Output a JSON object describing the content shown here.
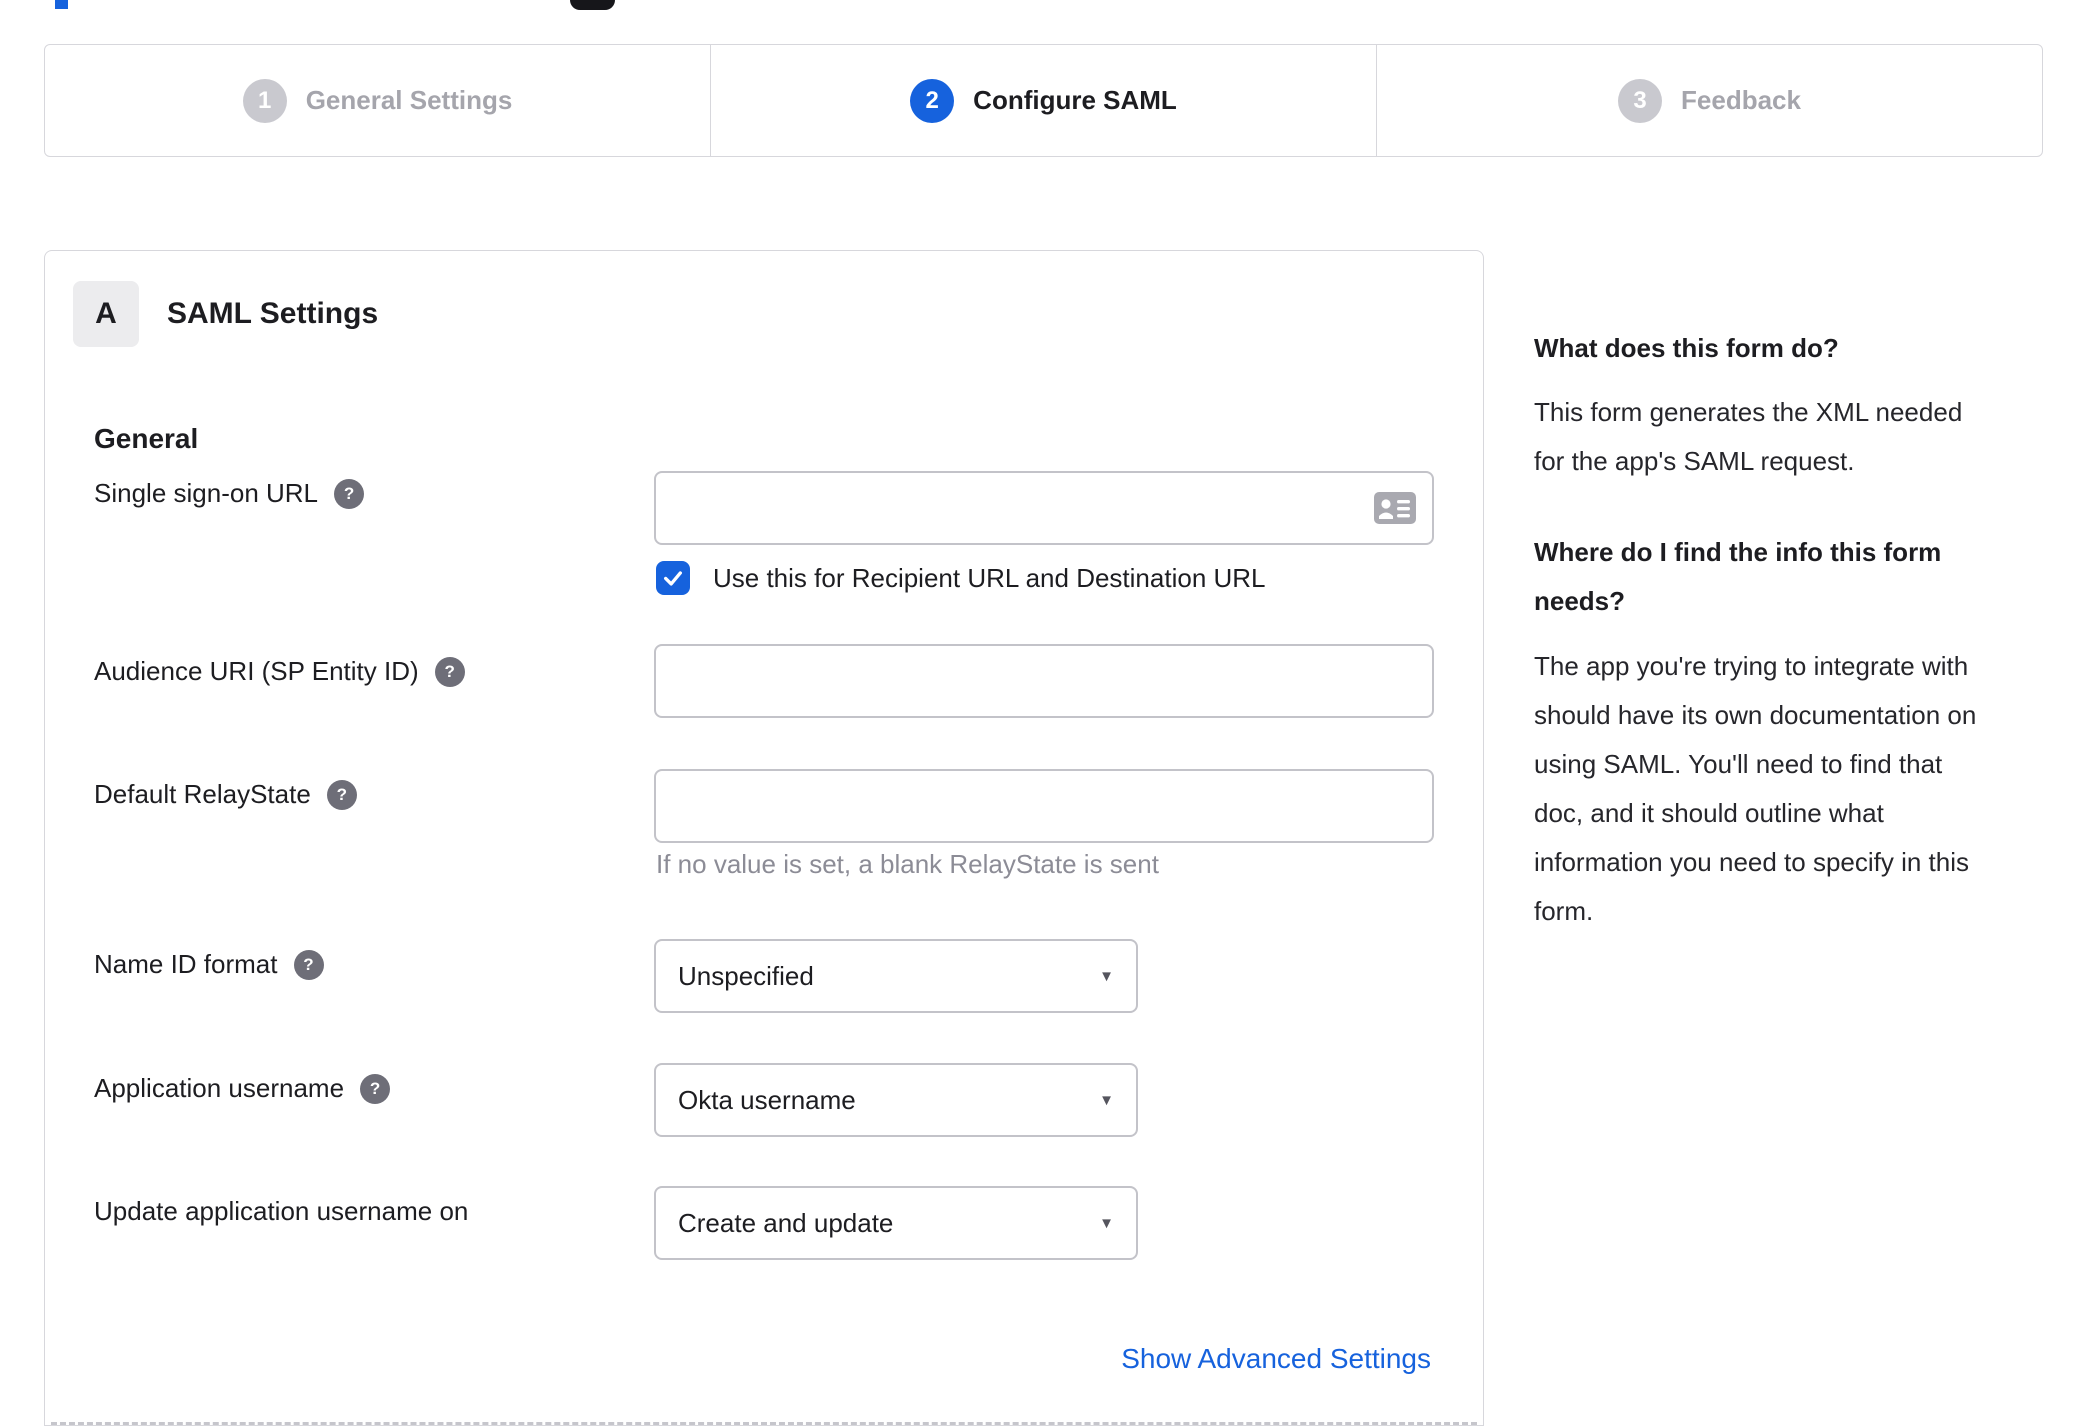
{
  "colors": {
    "accent_blue": "#1662dd",
    "inactive_gray": "#c9c9cf",
    "border_gray": "#d7d7dc",
    "helper_gray": "#8c8c96"
  },
  "stepper": {
    "steps": [
      {
        "number": "1",
        "label": "General Settings",
        "state": "inactive"
      },
      {
        "number": "2",
        "label": "Configure SAML",
        "state": "active"
      },
      {
        "number": "3",
        "label": "Feedback",
        "state": "inactive"
      }
    ]
  },
  "panel": {
    "badge": "A",
    "title": "SAML Settings",
    "section_heading": "General",
    "rows": [
      {
        "label": "Single sign-on URL",
        "value": "",
        "checkbox_label": "Use this for Recipient URL and Destination URL",
        "checkbox_checked": true
      },
      {
        "label": "Audience URI (SP Entity ID)",
        "value": ""
      },
      {
        "label": "Default RelayState",
        "value": "",
        "helper": "If no value is set, a blank RelayState is sent"
      },
      {
        "label": "Name ID format",
        "value": "Unspecified"
      },
      {
        "label": "Application username",
        "value": "Okta username"
      },
      {
        "label": "Update application username on",
        "value": "Create and update"
      }
    ],
    "advanced_link": "Show Advanced Settings"
  },
  "sidebar": {
    "q1": "What does this form do?",
    "a1": "This form generates the XML needed for the app's SAML request.",
    "q2": "Where do I find the info this form needs?",
    "a2": "The app you're trying to integrate with should have its own documentation on using SAML. You'll need to find that doc, and it should outline what information you need to specify in this form."
  }
}
